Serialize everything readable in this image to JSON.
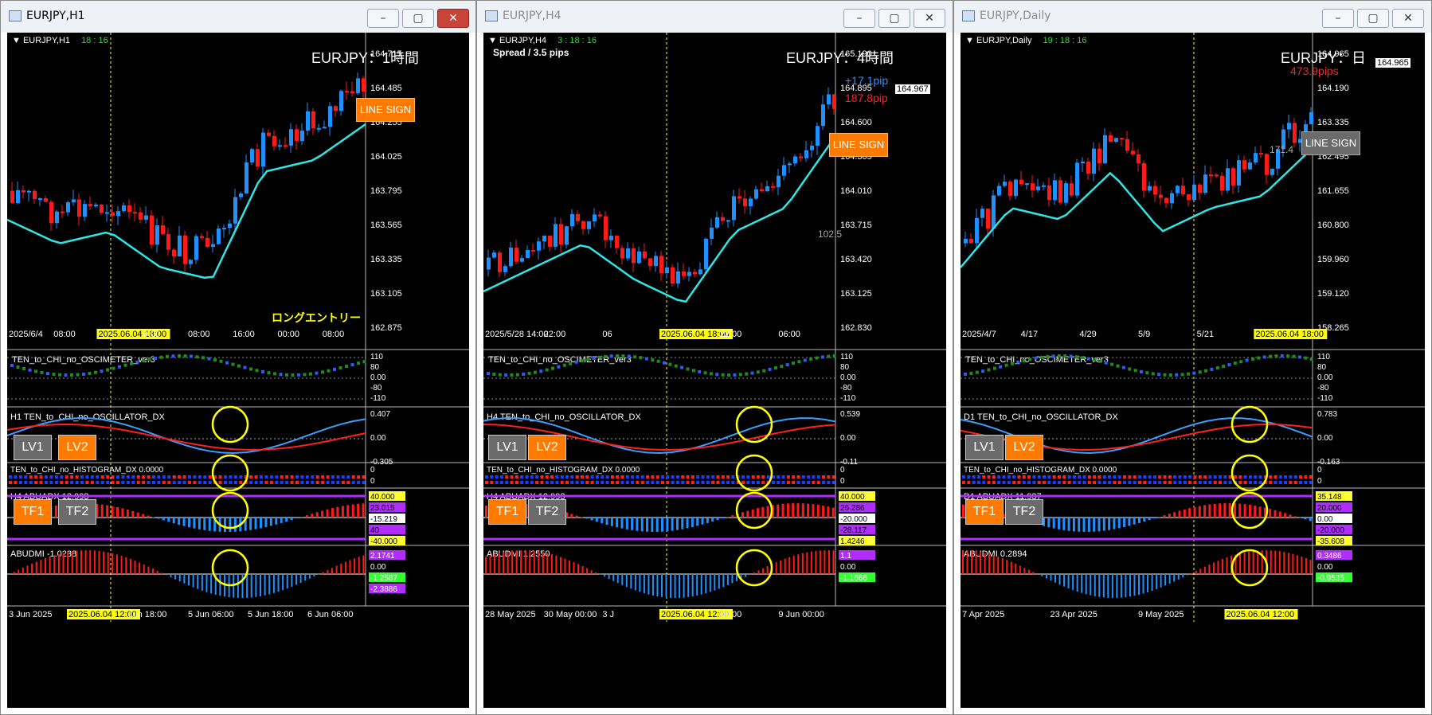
{
  "windows": [
    {
      "title": "EURJPY,H1",
      "symbol": "EURJPY,H1",
      "timer": "18 : 16",
      "big_title": "EURJPY：1時間",
      "line_sign": "LINE SIGN",
      "entry_label": "ロングエントリー",
      "price_ticks": [
        "164.715",
        "164.485",
        "164.255",
        "164.025",
        "163.795",
        "163.565",
        "163.335",
        "163.105",
        "162.875"
      ],
      "time_labels": [
        "2025/6/4",
        "08:00",
        "2025.06.04 18:00",
        "0:00",
        "08:00",
        "16:00",
        "00:00",
        "08:00"
      ],
      "osc1_title": "TEN_to_CHI_no_OSCIMETER_ver3",
      "osc1_scale": [
        "110",
        "80",
        "0.00",
        "-80",
        "-110"
      ],
      "lv1": "LV1",
      "lv2": "LV2",
      "osc2_title": "H1 TEN_to_CHI_no_OSCILLATOR_DX",
      "osc2_scale": [
        "0.407",
        "0.00",
        "-0.305"
      ],
      "tf1": "TF1",
      "tf2": "TF2",
      "hist_title": "TEN_to_CHI_no_HISTOGRAM_DX 0.0000",
      "hist_scale": [
        "0",
        "0"
      ],
      "abuadx_title": "H4 ABUADX  12.993",
      "abuadx_tags": [
        "40.000",
        "23.015",
        "-15.219",
        "40",
        "-40.000"
      ],
      "abudmi_title": "ABUDMI  -1.0238",
      "abudmi_tags": [
        "2.1741",
        "0.00",
        "-1.2587",
        "-2.3886"
      ],
      "bottom_dates": [
        "3 Jun 2025",
        "2025.06.04 12:00",
        "Jun 18:00",
        "5 Jun 06:00",
        "5 Jun 18:00",
        "6 Jun 06:00"
      ]
    },
    {
      "title": "EURJPY,H4",
      "symbol": "EURJPY,H4",
      "timer": "3 : 18 : 16",
      "spread": "Spread / 3.5 pips",
      "big_title": "EURJPY：4時間",
      "pip_blue": "+17.1pip",
      "pip_red": "187.8pip",
      "price_box": "164.967",
      "line_sign": "LINE SIGN",
      "side_value": "102.5",
      "price_ticks": [
        "165.190",
        "164.895",
        "164.600",
        "164.305",
        "164.010",
        "163.715",
        "163.420",
        "163.125",
        "162.830"
      ],
      "time_labels": [
        "2025/5/28 14:00",
        "22:00",
        "06",
        "2025.06.04 18:00",
        "22:00",
        "06:00"
      ],
      "osc1_title": "TEN_to_CHI_no_OSCIMETER_ver3",
      "osc1_scale": [
        "110",
        "80",
        "0.00",
        "-80",
        "-110"
      ],
      "lv1": "LV1",
      "lv2": "LV2",
      "osc2_title": "H4 TEN_to_CHI_no_OSCILLATOR_DX",
      "osc2_scale": [
        "0.539",
        "0.00",
        "-0.11"
      ],
      "tf1": "TF1",
      "tf2": "TF2",
      "hist_title": "TEN_to_CHI_no_HISTOGRAM_DX 0.0000",
      "hist_scale": [
        "0",
        "0"
      ],
      "abuadx_title": "H4 ABUADX  12.993",
      "abuadx_tags": [
        "40.000",
        "26.286",
        "-20.000",
        "-28.117",
        "1.4246"
      ],
      "abudmi_title": "ABUDMI  1.2550",
      "abudmi_tags": [
        "1.1",
        "0.00",
        "-1.1666"
      ],
      "bottom_dates": [
        "28 May 2025",
        "30 May 00:00",
        "3 J",
        "2025.06.04 12:00",
        "00:00",
        "9 Jun 00:00"
      ]
    },
    {
      "title": "EURJPY,Daily",
      "symbol": "EURJPY,Daily",
      "timer": "19 : 18 : 16",
      "big_title": "EURJPY：日",
      "pip_red": "473.9pips",
      "price_box": "164.965",
      "line_sign": "LINE SIGN",
      "side_value": "171.4",
      "price_ticks": [
        "164.965",
        "164.190",
        "163.335",
        "162.495",
        "161.655",
        "160.800",
        "159.960",
        "159.120",
        "158.265"
      ],
      "time_labels": [
        "2025/4/7",
        "4/17",
        "4/29",
        "5/9",
        "5/21",
        "2025.06.04 18:00"
      ],
      "osc1_title": "TEN_to_CHI_no_OSCIMETER_ver3",
      "osc1_scale": [
        "110",
        "80",
        "0.00",
        "-80",
        "-110"
      ],
      "lv1": "LV1",
      "lv2": "LV2",
      "osc2_title": "D1 TEN_to_CHI_no_OSCILLATOR_DX",
      "osc2_scale": [
        "0.783",
        "0.00",
        "-0.163"
      ],
      "tf1": "TF1",
      "tf2": "TF2",
      "hist_title": "TEN_to_CHI_no_HISTOGRAM_DX 0.0000",
      "hist_scale": [
        "0",
        "0"
      ],
      "abuadx_title": "D1 ABUADX  11.937",
      "abuadx_tags": [
        "35.148",
        "20.000",
        "0.00",
        "-20.000",
        "-35.608"
      ],
      "abudmi_title": "ABUDMI  0.2894",
      "abudmi_tags": [
        "0.3486",
        "0.00",
        "-0.9535"
      ],
      "bottom_dates": [
        "7 Apr 2025",
        "23 Apr 2025",
        "9 May 2025",
        "2025.06.04 12:00"
      ]
    }
  ],
  "colors": {
    "bull": "#1e90ff",
    "bear": "#ff1a1a",
    "ma": "#2fe6e6",
    "ma_magenta": "#ff2dff",
    "accent": "#ff7b00",
    "highlight": "#ffff00"
  }
}
